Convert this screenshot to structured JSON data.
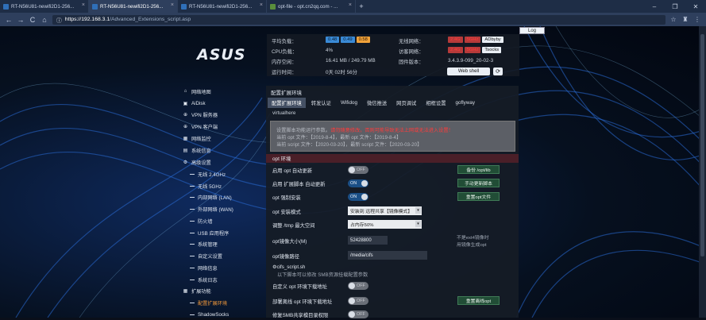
{
  "browser": {
    "tabs": [
      {
        "title": "RT-N56U81-newifi2D1-256..."
      },
      {
        "title": "RT-N56U81-newifi2D1-256..."
      },
      {
        "title": "RT-N56U81-newifi2D1-256..."
      },
      {
        "title": "opt-file - opt.cn2qq.com - ..."
      }
    ],
    "new_tab": "+",
    "window_controls": [
      "–",
      "❐",
      "✕"
    ],
    "nav": {
      "back": "←",
      "forward": "→",
      "reload": "C",
      "home": "⌂"
    },
    "url_lock": "ⓘ",
    "url_host": "https://192.168.3.1",
    "url_path": "/Advanced_Extensions_script.asp",
    "toolbar_icons": [
      "☆",
      "♜",
      "⋮"
    ]
  },
  "header": {
    "logout_label": "Log",
    "logo_text": "ASUS",
    "system_load_label": "平均负载：",
    "system_load_values": [
      "0.48",
      "0.49",
      "0.58"
    ],
    "cpu_label": "CPU负载：",
    "cpu_value": "4%",
    "mem_label": "内存空闲：",
    "mem_value": "16.41 MB / 249.79 MB",
    "uptime_label": "运行时间：",
    "uptime_value": "0天 02时 56分",
    "wireless_label": "无线网络：",
    "wireless_chips": [
      "2.4G",
      "5GHz",
      "ADbyby"
    ],
    "access_label": "访客网络：",
    "access_chips": [
      "2.4G",
      "5GHz",
      "Tsocks"
    ],
    "firmware_label": "固件版本：",
    "firmware_value": "3.4.3.9-099_20-02-3",
    "webshell_label": "Web shell",
    "refresh_icon": "⟳"
  },
  "sidebar": {
    "items": [
      {
        "icon": "⌂",
        "label": "网络地图"
      },
      {
        "icon": "▣",
        "label": "AiDisk"
      },
      {
        "icon": "⊕",
        "label": "VPN 服务器"
      },
      {
        "icon": "⊕",
        "label": "VPN 客户端"
      },
      {
        "icon": "▦",
        "label": "网络监控"
      },
      {
        "icon": "▤",
        "label": "系统信息"
      },
      {
        "icon": "⚙",
        "label": "高级设置"
      }
    ],
    "subitems": [
      {
        "label": "无线 2.4GHz"
      },
      {
        "label": "无线 5GHz"
      },
      {
        "label": "内部网络 (LAN)"
      },
      {
        "label": "外部网络 (WAN)"
      },
      {
        "label": "防火墙"
      },
      {
        "label": "USB 应用程序"
      },
      {
        "label": "系统管理"
      },
      {
        "label": "自定义设置"
      },
      {
        "label": "网络信息"
      },
      {
        "label": "系统日志"
      }
    ],
    "ext_label": "扩展功能",
    "ext_icon": "▦",
    "ext_subitems": [
      {
        "label": "配置扩展环境"
      },
      {
        "label": "ShadowSocks"
      }
    ]
  },
  "main": {
    "title": "配置扩展环境",
    "tabs": [
      "配置扩展环境",
      "转发认证",
      "Wifidog",
      "微信推送",
      "网页调试",
      "相框设置",
      "goflyway"
    ],
    "virtualhere": "virtualhere",
    "notice_line1_a": "设置脚本功能运行参数。",
    "notice_line1_b": "请勿随意修改，否则可能导致无法上网或无法进入设置！",
    "notice_line2": "当前 opt 文件：【2019-8-4】，最新 opt 文件：【2019-8-4】",
    "notice_line3": "当前 script 文件：【2020-03-20】，最新 script 文件：【2020-03-20】",
    "section_opt": "opt 环境",
    "rows": {
      "opt_auto_update": {
        "label": "启用 opt 自动更新",
        "toggle": "OFF",
        "button": "备份 /opt/lib"
      },
      "ext_script_update": {
        "label": "启用 扩展脚本 自动更新",
        "toggle": "ON",
        "button": "手动更新脚本"
      },
      "opt_force_install": {
        "label": "opt 强制安装",
        "toggle": "ON",
        "button": "重置opt文件"
      },
      "opt_install_mode": {
        "label": "opt 安装模式",
        "value": "安装到 远程共享【镜像模式】",
        "caret": "▾"
      },
      "tmp_max_space": {
        "label": "调整 /tmp 最大空间",
        "value": "占内存50%",
        "caret": "▾"
      },
      "opt_mirror_size": {
        "label": "opt镜像大小(M)",
        "value": "52428800",
        "note1": "不是ext4镜像时",
        "note2": "用镜像生成opt"
      },
      "opt_mirror_path": {
        "label": "opt镜像路径",
        "value": "/media/cifs"
      },
      "cifs": {
        "label": "cifs_script.sh",
        "desc": "以下脚本可以修改 SMB资源挂载配置参数",
        "icon": "⚙"
      },
      "custom_opt_url": {
        "label": "自定义 opt 环境下载地址",
        "toggle": "OFF"
      },
      "deploy_opt_url": {
        "label": "部署离线 opt 环境下载地址",
        "toggle": "OFF",
        "button": "重置离线opt"
      },
      "smb_share": {
        "label": "修复SMB共享模目录权限",
        "toggle": "OFF"
      }
    }
  }
}
